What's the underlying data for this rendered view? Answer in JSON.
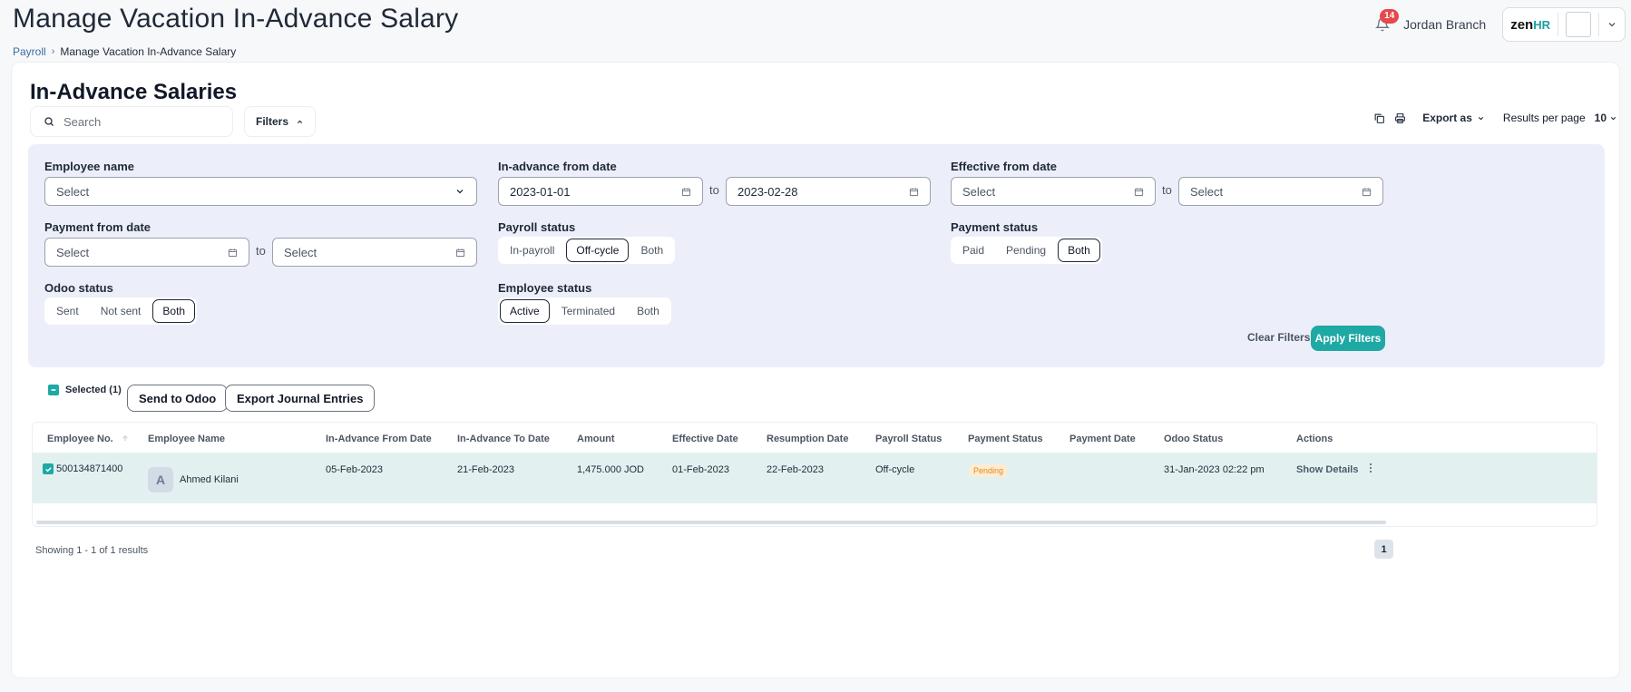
{
  "page": {
    "title": "Manage Vacation In-Advance Salary"
  },
  "breadcrumb": {
    "parent": "Payroll",
    "current": "Manage Vacation In-Advance Salary"
  },
  "topbar": {
    "notifications": "14",
    "user_name": "Jordan Branch",
    "logo_zen": "zen",
    "logo_hr": "HR"
  },
  "section": {
    "title": "In-Advance Salaries"
  },
  "toolbar": {
    "search_placeholder": "Search",
    "filters_label": "Filters",
    "export_label": "Export as",
    "rpp_label": "Results per page",
    "rpp_value": "10"
  },
  "filters": {
    "employee_name": {
      "label": "Employee name",
      "value": "Select"
    },
    "inadvance": {
      "label": "In-advance from date",
      "from": "2023-01-01",
      "to": "2023-02-28",
      "to_word": "to"
    },
    "effective": {
      "label": "Effective from date",
      "from": "Select",
      "to": "Select",
      "to_word": "to"
    },
    "payment_date": {
      "label": "Payment from date",
      "from": "Select",
      "to": "Select",
      "to_word": "to"
    },
    "payroll_status": {
      "label": "Payroll status",
      "options": [
        "In-payroll",
        "Off-cycle",
        "Both"
      ],
      "selected": "Off-cycle"
    },
    "payment_status": {
      "label": "Payment status",
      "options": [
        "Paid",
        "Pending",
        "Both"
      ],
      "selected": "Both"
    },
    "odoo_status": {
      "label": "Odoo status",
      "options": [
        "Sent",
        "Not sent",
        "Both"
      ],
      "selected": "Both"
    },
    "employee_status": {
      "label": "Employee status",
      "options": [
        "Active",
        "Terminated",
        "Both"
      ],
      "selected": "Active"
    },
    "clear_label": "Clear Filters",
    "apply_label": "Apply Filters"
  },
  "actions": {
    "selected_label": "Selected (1)",
    "send_odoo": "Send to Odoo",
    "export_journal": "Export Journal Entries"
  },
  "table": {
    "columns": [
      "Employee No.",
      "Employee Name",
      "In-Advance From Date",
      "In-Advance To Date",
      "Amount",
      "Effective Date",
      "Resumption Date",
      "Payroll Status",
      "Payment Status",
      "Payment Date",
      "Odoo Status",
      "Actions"
    ],
    "rows": [
      {
        "employee_no": "500134871400",
        "avatar_letter": "A",
        "employee_name": "Ahmed Kilani",
        "from_date": "05-Feb-2023",
        "to_date": "21-Feb-2023",
        "amount": "1,475.000 JOD",
        "effective_date": "01-Feb-2023",
        "resumption_date": "22-Feb-2023",
        "payroll_status": "Off-cycle",
        "payment_status": "Pending",
        "payment_date": "",
        "odoo_status": "31-Jan-2023 02:22 pm",
        "action_label": "Show Details"
      }
    ]
  },
  "footer": {
    "showing": "Showing 1 - 1 of 1 results",
    "page": "1"
  },
  "colors": {
    "accent": "#1ea9a4",
    "filter_panel": "#eceff9",
    "row_selected": "#e2f1f0",
    "badge_red": "#e5484d",
    "pending": "#e08a1e"
  }
}
